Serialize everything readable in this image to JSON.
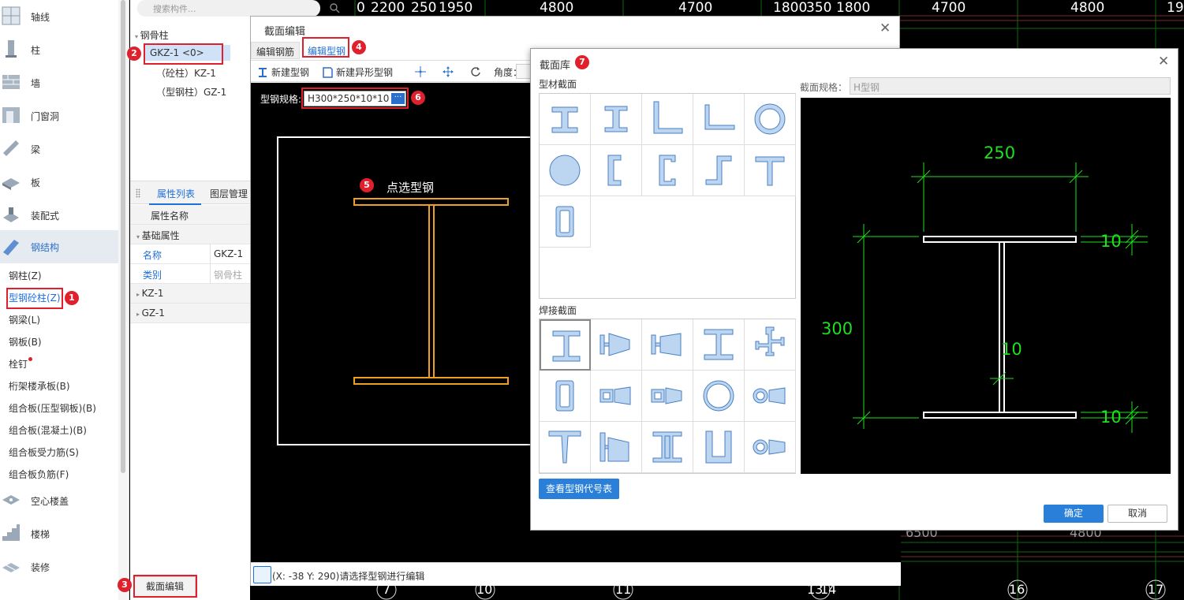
{
  "sidebar": {
    "nav_top": [
      "轴线",
      "柱",
      "墙",
      "门窗洞",
      "梁",
      "板",
      "装配式",
      "钢结构"
    ],
    "sub_items": [
      "钢柱(Z)",
      "型钢砼柱(Z)",
      "钢梁(L)",
      "钢板(B)",
      "栓钉",
      "桁架楼承板(B)",
      "组合板(压型钢板)(B)",
      "组合板(混凝土)(B)",
      "组合板受力筋(S)",
      "组合板负筋(F)"
    ],
    "nav_bottom": [
      "空心楼盖",
      "楼梯",
      "装修"
    ]
  },
  "panel": {
    "search_placeholder": "搜索构件...",
    "tree_root": "钢骨柱",
    "tree_selected": "GKZ-1 <0>",
    "tree_children": [
      "（砼柱）KZ-1",
      "（型钢柱）GZ-1"
    ],
    "tabs": [
      "属性列表",
      "图层管理"
    ],
    "header": "属性名称",
    "group_basic": "基础属性",
    "rows": [
      {
        "key": "名称",
        "value": "GKZ-1"
      },
      {
        "key": "类别",
        "value": "钢骨柱"
      }
    ],
    "groups": [
      "KZ-1",
      "GZ-1"
    ],
    "bottom_tab": "截面编辑"
  },
  "cad": {
    "top_dims": [
      "0",
      "2200",
      "250",
      "1950",
      "4800",
      "4700",
      "1800",
      "350",
      "1800",
      "4700",
      "4800",
      "19"
    ],
    "bottom_axes": [
      "7",
      "10",
      "11",
      "13",
      "14",
      "16",
      "17"
    ],
    "mid_dims": [
      "6500",
      "4800"
    ]
  },
  "edit_window": {
    "title": "截面编辑",
    "tabs": [
      "编辑钢筋",
      "编辑型钢"
    ],
    "toolbar": {
      "new_steel": "新建型钢",
      "new_special": "新建异形型钢",
      "angle": "角度："
    },
    "spec_label": "型钢规格:",
    "spec_value": "H300*250*10*10",
    "spec_more": "···",
    "hint": "点选型钢",
    "status": "(X: -38 Y: 290)请选择型钢进行编辑"
  },
  "library": {
    "title": "截面库",
    "profile_heading": "型材截面",
    "welded_heading": "焊接截面",
    "spec_label": "截面规格：",
    "spec_value": "H型钢",
    "dims": {
      "width": "250",
      "height": "300",
      "flange_top": "10",
      "flange_bottom": "10",
      "web": "10"
    },
    "code_table_button": "查看型钢代号表",
    "ok": "确定",
    "cancel": "取消"
  },
  "annotations": [
    "1",
    "2",
    "3",
    "4",
    "5",
    "6",
    "7"
  ],
  "colors": {
    "accent": "#1e6fd9",
    "annotation": "#e0202c",
    "steel": "#f0a020",
    "dim": "#1ee01e"
  }
}
